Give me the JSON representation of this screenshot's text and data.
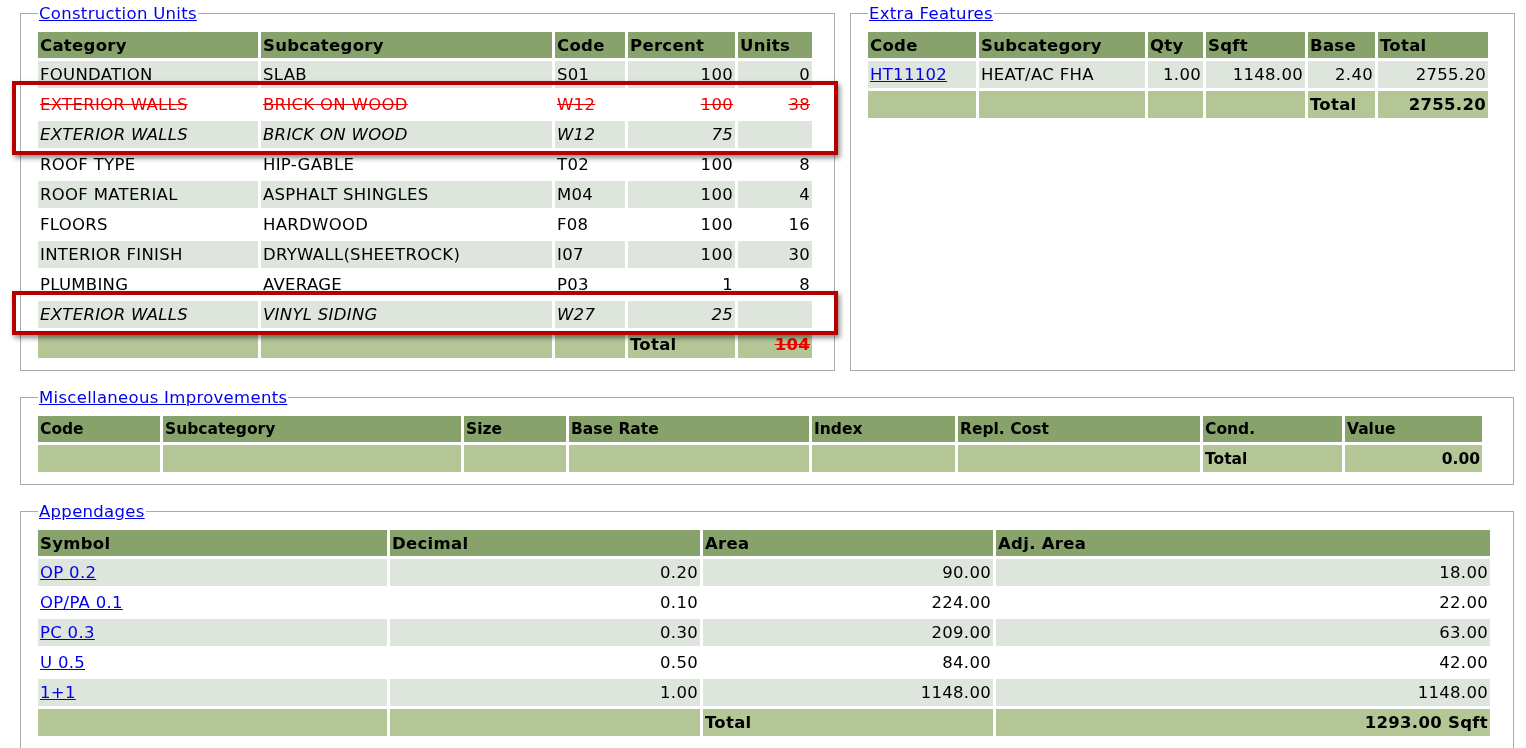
{
  "construction": {
    "legend": "Construction Units",
    "columns": [
      "Category",
      "Subcategory",
      "Code",
      "Percent",
      "Units"
    ],
    "rows": [
      {
        "category": "FOUNDATION",
        "subcategory": "SLAB",
        "code": "S01",
        "percent": "100",
        "units": "0",
        "kind": "normal",
        "highlighted": false
      },
      {
        "category": "EXTERIOR WALLS",
        "subcategory": "BRICK ON WOOD",
        "code": "W12",
        "percent": "100",
        "units": "38",
        "kind": "removed",
        "highlighted": true
      },
      {
        "category": "EXTERIOR WALLS",
        "subcategory": "BRICK ON WOOD",
        "code": "W12",
        "percent": "75",
        "kind": "revised",
        "highlighted": true
      },
      {
        "category": "ROOF TYPE",
        "subcategory": "HIP-GABLE",
        "code": "T02",
        "percent": "100",
        "units": "8",
        "kind": "normal",
        "highlighted": false
      },
      {
        "category": "ROOF MATERIAL",
        "subcategory": "ASPHALT SHINGLES",
        "code": "M04",
        "percent": "100",
        "units": "4",
        "kind": "normal",
        "highlighted": false
      },
      {
        "category": "FLOORS",
        "subcategory": "HARDWOOD",
        "code": "F08",
        "percent": "100",
        "units": "16",
        "kind": "normal",
        "highlighted": false
      },
      {
        "category": "INTERIOR FINISH",
        "subcategory": "DRYWALL(SHEETROCK)",
        "code": "I07",
        "percent": "100",
        "units": "30",
        "kind": "normal",
        "highlighted": false
      },
      {
        "category": "PLUMBING",
        "subcategory": "AVERAGE",
        "code": "P03",
        "percent": "1",
        "units": "8",
        "kind": "normal",
        "highlighted": false
      },
      {
        "category": "EXTERIOR WALLS",
        "subcategory": "VINYL SIDING",
        "code": "W27",
        "percent": "25",
        "kind": "revised",
        "highlighted": true
      }
    ],
    "total_label": "Total",
    "total_units": "104",
    "total_struck": true
  },
  "extra_features": {
    "legend": "Extra Features",
    "columns": [
      "Code",
      "Subcategory",
      "Qty",
      "Sqft",
      "Base",
      "Total"
    ],
    "rows": [
      {
        "code": "HT11102",
        "subcategory": "HEAT/AC FHA",
        "qty": "1.00",
        "sqft": "1148.00",
        "base": "2.40",
        "total": "2755.20"
      }
    ],
    "total_label": "Total",
    "total": "2755.20"
  },
  "misc_improvements": {
    "legend": "Miscellaneous Improvements",
    "columns": [
      "Code",
      "Subcategory",
      "Size",
      "Base Rate",
      "Index",
      "Repl. Cost",
      "Cond.",
      "Value"
    ],
    "total_label": "Total",
    "total": "0.00"
  },
  "appendages": {
    "legend": "Appendages",
    "columns": [
      "Symbol",
      "Decimal",
      "Area",
      "Adj. Area"
    ],
    "rows": [
      {
        "symbol": "OP 0.2",
        "decimal": "0.20",
        "area": "90.00",
        "adj_area": "18.00"
      },
      {
        "symbol": "OP/PA 0.1",
        "decimal": "0.10",
        "area": "224.00",
        "adj_area": "22.00"
      },
      {
        "symbol": "PC 0.3",
        "decimal": "0.30",
        "area": "209.00",
        "adj_area": "63.00"
      },
      {
        "symbol": "U 0.5",
        "decimal": "0.50",
        "area": "84.00",
        "adj_area": "42.00"
      },
      {
        "symbol": "1+1",
        "decimal": "1.00",
        "area": "1148.00",
        "adj_area": "1148.00"
      }
    ],
    "total_label": "Total",
    "total": "1293.00 Sqft"
  }
}
